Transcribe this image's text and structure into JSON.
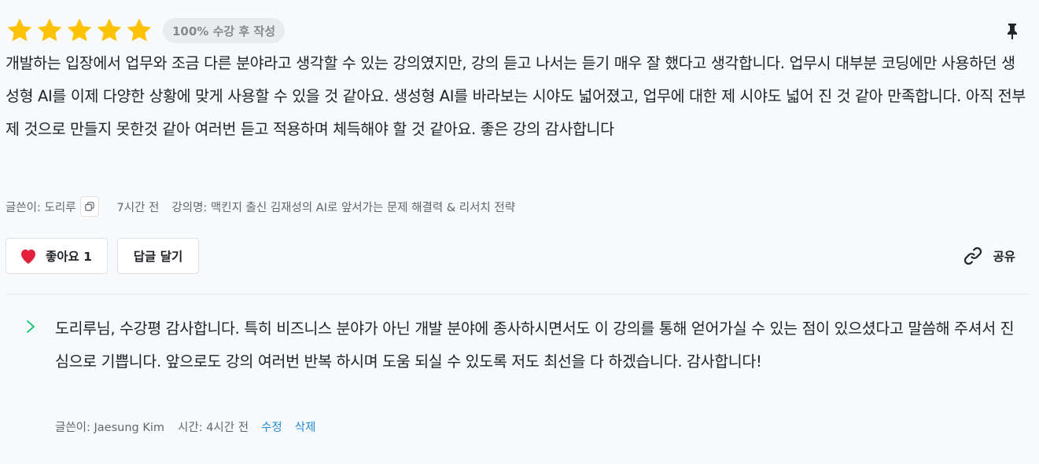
{
  "review": {
    "rating": 5,
    "rating_max": 5,
    "badge": "100% 수강 후 작성",
    "text": "개발하는 입장에서 업무와 조금 다른 분야라고 생각할 수 있는 강의였지만, 강의 듣고 나서는 듣기 매우 잘 했다고 생각합니다. 업무시 대부분 코딩에만 사용하던 생성형 AI를 이제 다양한 상황에 맞게 사용할 수 있을 것 같아요. 생성형 AI를 바라보는 시야도 넓어졌고, 업무에 대한 제 시야도 넓어 진 것 같아 만족합니다. 아직 전부 제 것으로 만들지 못한것 같아 여러번 듣고 적용하며 체득해야 할 것 같아요. 좋은 강의 감사합니다",
    "author": "글쓴이: 도리루",
    "time": "7시간 전",
    "course": "강의명: 맥킨지 출신 김재성의 AI로 앞서가는 문제 해결력 & 리서치 전략",
    "like_label": "좋아요 1",
    "reply_label": "답글 달기",
    "share_label": "공유"
  },
  "answer": {
    "text": "도리루님, 수강평 감사합니다. 특히 비즈니스 분야가 아닌 개발 분야에 종사하시면서도 이 강의를 통해 얻어가실 수 있는 점이 있으셨다고 말씀해 주셔서 진심으로 기쁩니다. 앞으로도 강의 여러번 반복 하시며 도움 되실 수 있도록 저도 최선을 다 하겠습니다. 감사합니다!",
    "author": "글쓴이: Jaesung Kim",
    "time": "시간: 4시간 전",
    "edit_label": "수정",
    "delete_label": "삭제"
  },
  "icons": {
    "star": "star-icon",
    "pin": "pin-icon",
    "copy": "copy-icon",
    "heart": "heart-icon",
    "share": "link-icon",
    "expand": "chevron-right-icon"
  },
  "colors": {
    "star": "#fdc202",
    "heart": "#e5203f",
    "link": "#1e8cd6",
    "reply_chevron": "#00c471",
    "background": "#f8f9fa"
  }
}
